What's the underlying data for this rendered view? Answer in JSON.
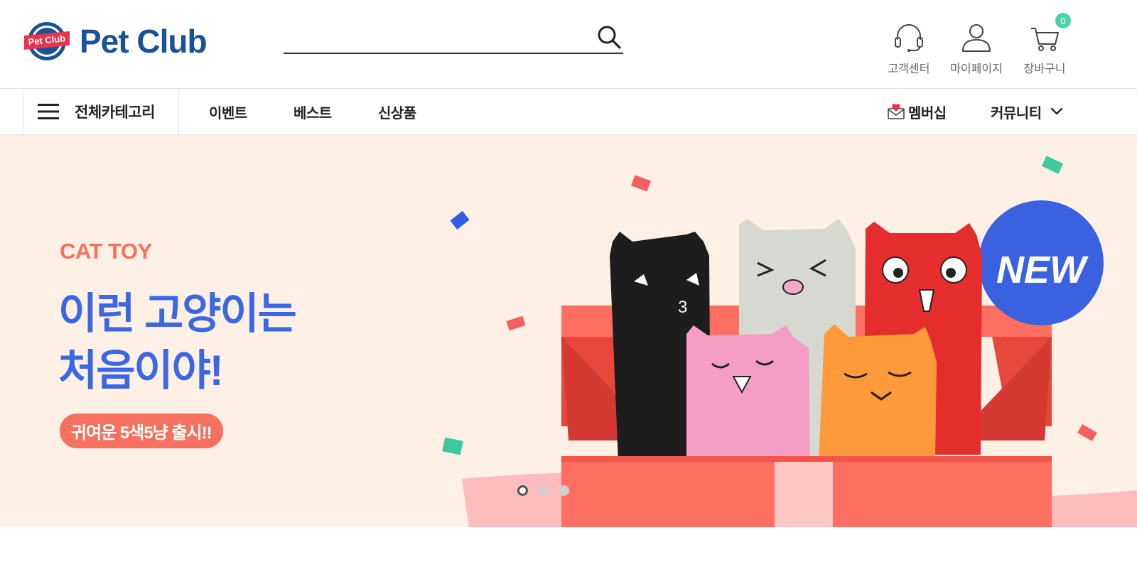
{
  "header": {
    "logo_text": "Pet Club",
    "logo_badge_text": "Pet Club",
    "search": {
      "placeholder": "",
      "value": ""
    },
    "utils": {
      "customer_center": "고객센터",
      "mypage": "마이페이지",
      "cart": "장바구니",
      "cart_count": "0"
    }
  },
  "nav": {
    "all_categories": "전체카테고리",
    "items": [
      "이벤트",
      "베스트",
      "신상품"
    ],
    "membership": "멤버십",
    "community": "커뮤니티"
  },
  "banner": {
    "tag": "CAT TOY",
    "title_line1": "이런 고양이는",
    "title_line2": "처음이야!",
    "pill": "귀여운 5색5냥 출시!!",
    "badge": "NEW",
    "slide_count": 3,
    "active_slide": 1
  },
  "colors": {
    "brand_navy": "#1a5296",
    "banner_bg": "#fff0e5",
    "accent_coral": "#f5705e",
    "title_blue": "#3c67e3",
    "cart_badge": "#4fd1b0",
    "new_badge": "#3a62e0"
  },
  "icons": {
    "search": "search-icon",
    "customer_center": "headset-icon",
    "mypage": "user-icon",
    "cart": "cart-icon",
    "menu": "hamburger-menu-icon",
    "membership": "mail-heart-icon",
    "community": "chevron-down-icon"
  }
}
